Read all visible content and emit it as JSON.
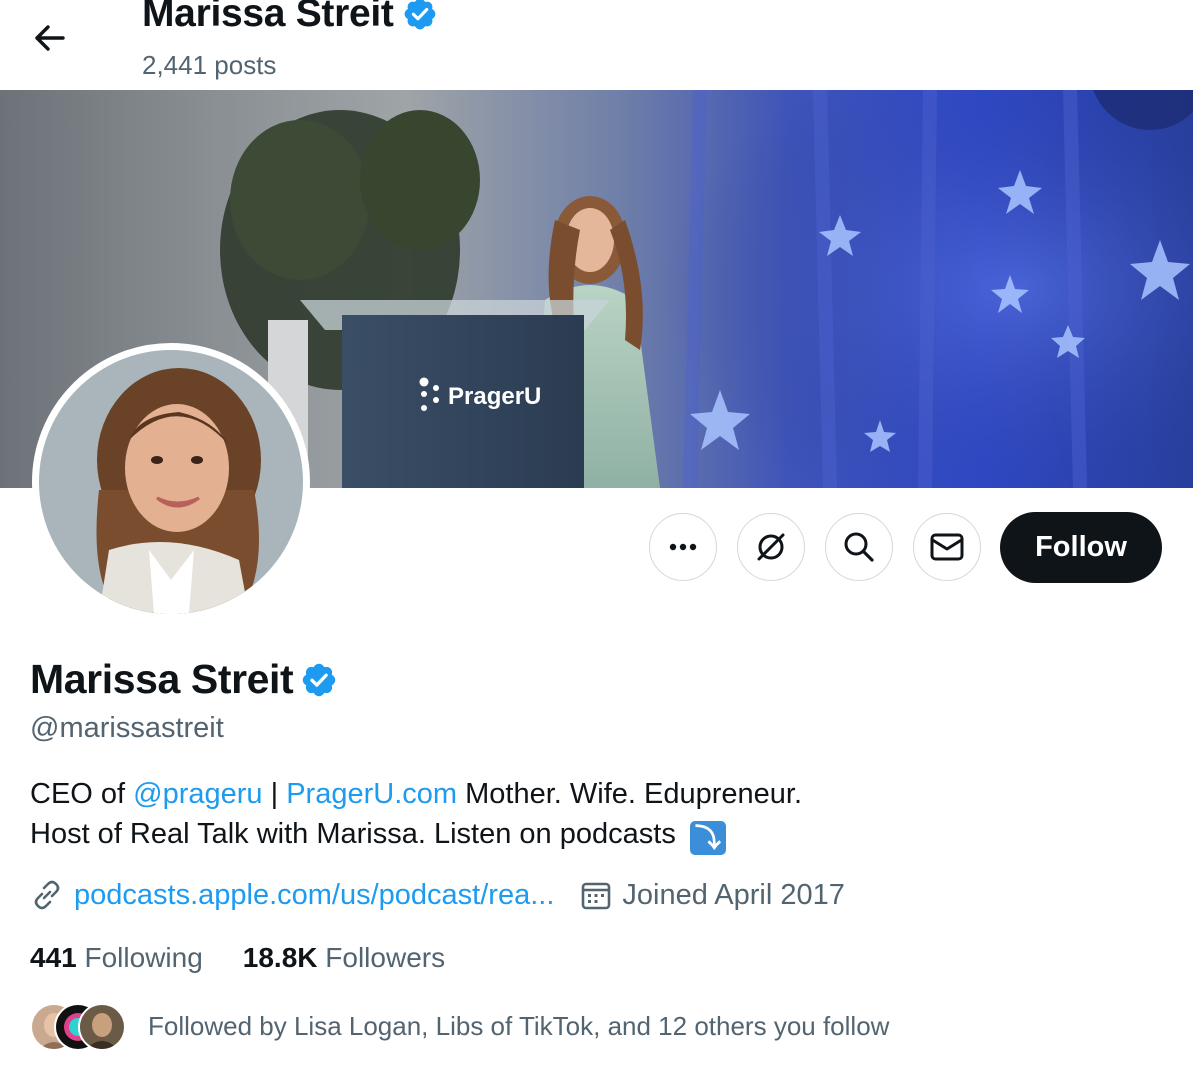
{
  "header": {
    "title": "Marissa Streit",
    "posts_count": "2,441 posts"
  },
  "profile": {
    "name": "Marissa Streit",
    "handle": "@marissastreit",
    "bio": {
      "line1_prefix": "CEO of ",
      "mention": "@prageru",
      "separator": " | ",
      "website_link": "PragerU.com",
      "line1_suffix": " Mother. Wife. Edupreneur.",
      "line2": "Host of Real Talk with Marissa. Listen on podcasts",
      "emoji": "⤵"
    },
    "url": "podcasts.apple.com/us/podcast/rea...",
    "joined": "Joined April 2017",
    "following_count": "441",
    "following_label": "Following",
    "followers_count": "18.8K",
    "followers_label": "Followers",
    "followed_by": "Followed by Lisa Logan, Libs of TikTok, and 12 others you follow"
  },
  "banner": {
    "podium_logo_text": "PragerU"
  },
  "actions": {
    "follow_label": "Follow",
    "icons": [
      "more-icon",
      "grok-icon",
      "search-icon",
      "message-icon"
    ]
  },
  "colors": {
    "accent": "#1d9bf0",
    "verified": "#1d9bf0",
    "text_primary": "#0f1419",
    "text_secondary": "#536471",
    "follow_button_bg": "#0f1419",
    "border": "#cfd9de"
  }
}
